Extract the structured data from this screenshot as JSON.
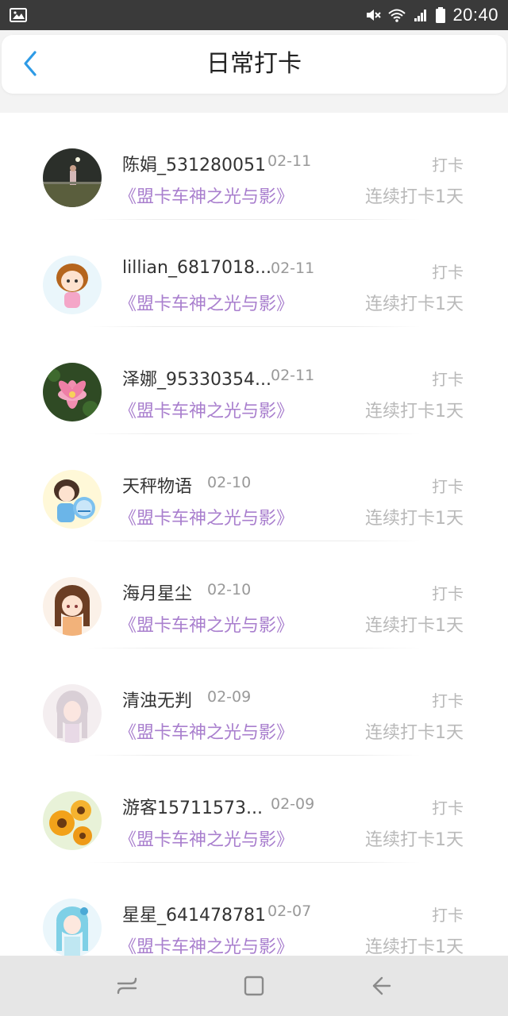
{
  "status_bar": {
    "time": "20:40",
    "icons": [
      "gallery-icon",
      "mute-icon",
      "wifi-icon",
      "signal-icon",
      "battery-icon"
    ]
  },
  "header": {
    "title": "日常打卡",
    "back_icon": "chevron-left-icon",
    "accent_color": "#2e9be6"
  },
  "colors": {
    "book_title": "#a97fce",
    "muted": "#b9b9b9"
  },
  "checkins": [
    {
      "name": "陈娟_531280051",
      "date": "02-11",
      "action": "打卡",
      "book": "《盟卡车神之光与影》",
      "streak": "连续打卡1天"
    },
    {
      "name": "lillian_6817018...",
      "date": "02-11",
      "action": "打卡",
      "book": "《盟卡车神之光与影》",
      "streak": "连续打卡1天"
    },
    {
      "name": "泽娜_95330354...",
      "date": "02-11",
      "action": "打卡",
      "book": "《盟卡车神之光与影》",
      "streak": "连续打卡1天"
    },
    {
      "name": "天秤物语",
      "date": "02-10",
      "action": "打卡",
      "book": "《盟卡车神之光与影》",
      "streak": "连续打卡1天"
    },
    {
      "name": "海月星尘",
      "date": "02-10",
      "action": "打卡",
      "book": "《盟卡车神之光与影》",
      "streak": "连续打卡1天"
    },
    {
      "name": "清浊无判",
      "date": "02-09",
      "action": "打卡",
      "book": "《盟卡车神之光与影》",
      "streak": "连续打卡1天"
    },
    {
      "name": "游客15711573...",
      "date": "02-09",
      "action": "打卡",
      "book": "《盟卡车神之光与影》",
      "streak": "连续打卡1天"
    },
    {
      "name": "星星_641478781",
      "date": "02-07",
      "action": "打卡",
      "book": "《盟卡车神之光与影》",
      "streak": "连续打卡1天"
    }
  ],
  "nav_bar": {
    "icons": [
      "recent-apps-icon",
      "home-icon",
      "back-icon"
    ]
  }
}
